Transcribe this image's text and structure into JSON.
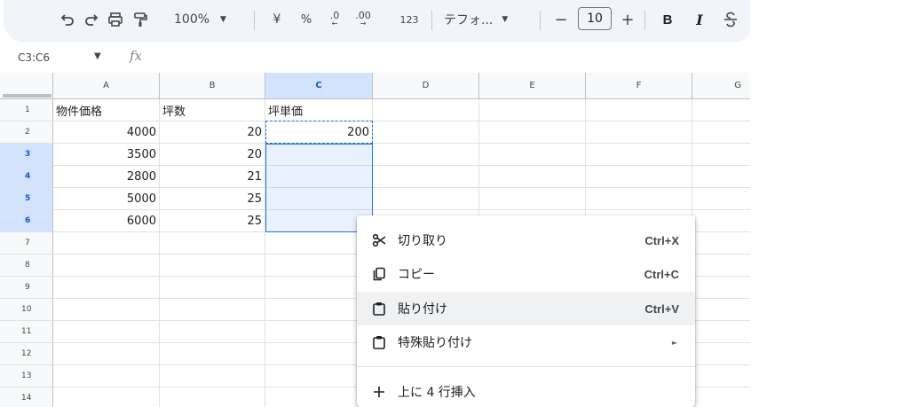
{
  "toolbar": {
    "zoom": "100%",
    "currency": "¥",
    "percent": "%",
    "dec_decrease": ".0",
    "dec_increase": ".00",
    "format_123": "123",
    "font_name": "テフォ...",
    "minus": "−",
    "font_size": "10",
    "plus": "+",
    "bold": "B",
    "italic": "I"
  },
  "formula_bar": {
    "name_box": "C3:C6",
    "fx": "fx"
  },
  "columns": [
    "A",
    "B",
    "C",
    "D",
    "E",
    "F",
    "G"
  ],
  "rows": [
    "1",
    "2",
    "3",
    "4",
    "5",
    "6",
    "7",
    "8",
    "9",
    "10",
    "11",
    "12",
    "13",
    "14"
  ],
  "cells": {
    "A1": "物件価格",
    "B1": "坪数",
    "C1": "坪単価",
    "A2": "4000",
    "B2": "20",
    "C2": "200",
    "A3": "3500",
    "B3": "20",
    "A4": "2800",
    "B4": "21",
    "A5": "5000",
    "B5": "25",
    "A6": "6000",
    "B6": "25"
  },
  "context_menu": {
    "items": [
      {
        "label": "切り取り",
        "shortcut": "Ctrl+X",
        "icon": "scissors-icon"
      },
      {
        "label": "コピー",
        "shortcut": "Ctrl+C",
        "icon": "copy-icon"
      },
      {
        "label": "貼り付け",
        "shortcut": "Ctrl+V",
        "icon": "clipboard-icon"
      },
      {
        "label": "特殊貼り付け",
        "submenu_arrow": "►",
        "icon": "clipboard-icon"
      },
      {
        "label": "上に 4 行挿入",
        "icon": "plus-icon"
      }
    ]
  },
  "colors": {
    "selection": "#1a73e8",
    "header_selected": "#d3e3fd",
    "toolbar_bg": "#f1f4f9"
  }
}
